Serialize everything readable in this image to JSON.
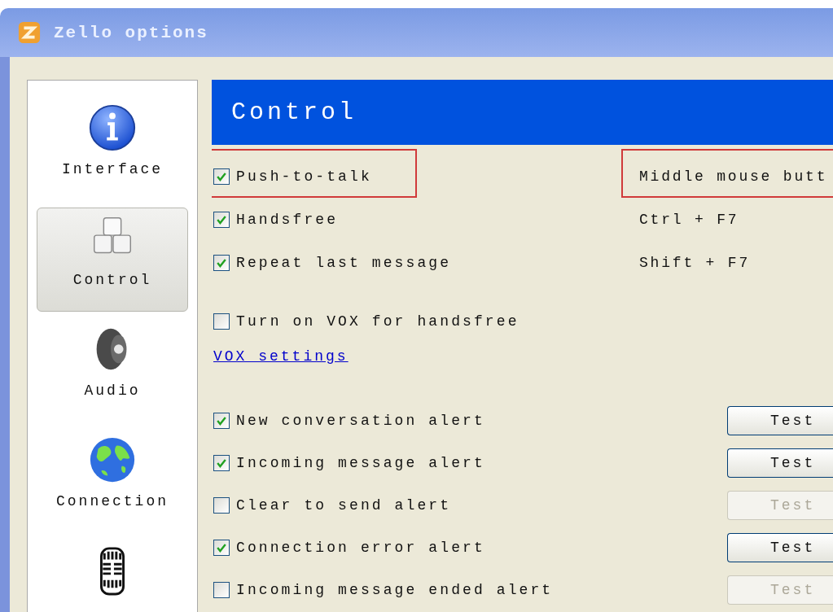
{
  "window": {
    "title": "Zello options"
  },
  "sidebar": {
    "items": [
      {
        "label": "Interface",
        "kind": "info",
        "selected": false
      },
      {
        "label": "Control",
        "kind": "keys",
        "selected": true
      },
      {
        "label": "Audio",
        "kind": "speaker",
        "selected": false
      },
      {
        "label": "Connection",
        "kind": "globe",
        "selected": false
      },
      {
        "kind": "mic",
        "selected": false
      }
    ]
  },
  "section": {
    "title": "Control"
  },
  "hotkey_options": [
    {
      "label": "Push-to-talk",
      "checked": true,
      "hotkey": "Middle mouse butt",
      "highlighted": true
    },
    {
      "label": "Handsfree",
      "checked": true,
      "hotkey": "Ctrl + F7",
      "highlighted": false
    },
    {
      "label": "Repeat last message",
      "checked": true,
      "hotkey": "Shift + F7",
      "highlighted": false
    }
  ],
  "vox": {
    "label": "Turn on VOX for handsfree",
    "checked": false
  },
  "vox_link": "VOX settings",
  "alerts": [
    {
      "label": "New conversation alert",
      "checked": true,
      "button": "Test",
      "disabled": false
    },
    {
      "label": "Incoming message alert",
      "checked": true,
      "button": "Test",
      "disabled": false
    },
    {
      "label": "Clear to send alert",
      "checked": false,
      "button": "Test",
      "disabled": true
    },
    {
      "label": "Connection error alert",
      "checked": true,
      "button": "Test",
      "disabled": false
    },
    {
      "label": "Incoming message ended alert",
      "checked": false,
      "button": "Test",
      "disabled": true
    }
  ]
}
